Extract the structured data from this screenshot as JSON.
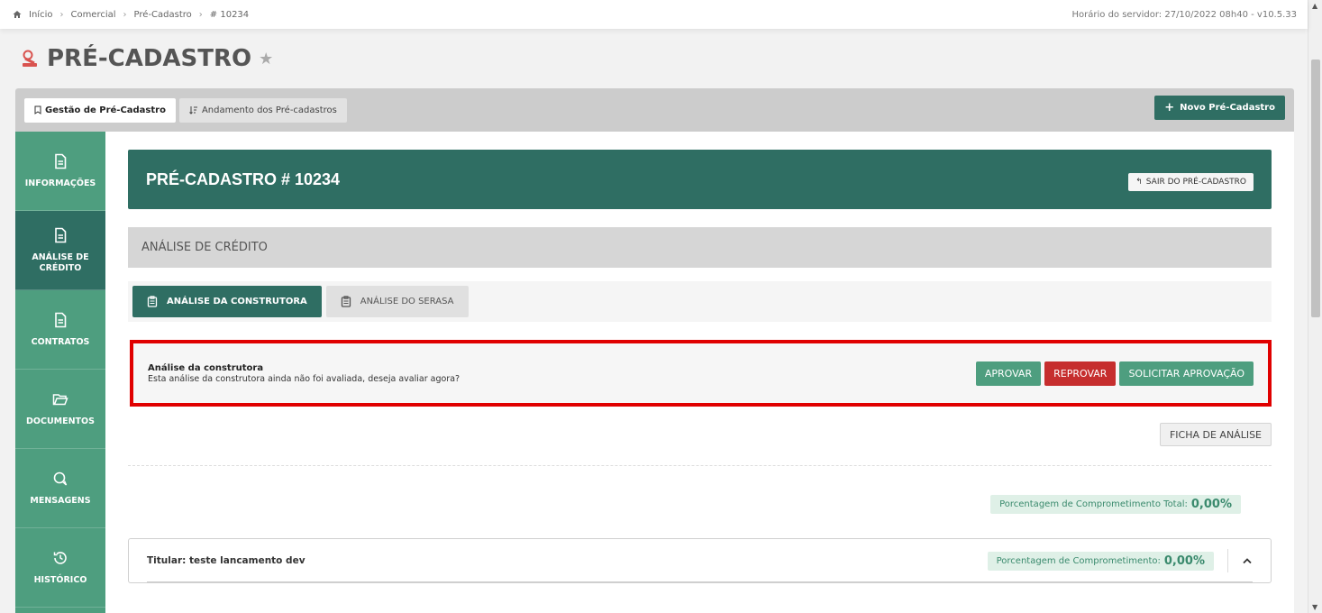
{
  "breadcrumb": [
    "Início",
    "Comercial",
    "Pré-Cadastro",
    "# 10234"
  ],
  "server_time": "Horário do servidor: 27/10/2022 08h40 - v10.5.33",
  "page_title": "PRÉ-CADASTRO",
  "tabs": {
    "gestao": "Gestão de Pré-Cadastro",
    "andamento": "Andamento dos Pré-cadastros",
    "novo": "Novo Pré-Cadastro"
  },
  "sidebar": {
    "items": [
      {
        "label": "INFORMAÇÕES",
        "icon": "document-icon"
      },
      {
        "label": "ANÁLISE DE CRÉDITO",
        "icon": "document-icon"
      },
      {
        "label": "CONTRATOS",
        "icon": "document-icon"
      },
      {
        "label": "DOCUMENTOS",
        "icon": "folder-icon"
      },
      {
        "label": "MENSAGENS",
        "icon": "chat-icon"
      },
      {
        "label": "HISTÓRICO",
        "icon": "history-icon"
      }
    ]
  },
  "header": {
    "title": "PRÉ-CADASTRO # 10234",
    "sair": "SAIR DO PRÉ-CADASTRO"
  },
  "section_title": "ANÁLISE DE CRÉDITO",
  "subtabs": {
    "construtora": "ANÁLISE DA CONSTRUTORA",
    "serasa": "ANÁLISE DO SERASA"
  },
  "alert": {
    "title": "Análise da construtora",
    "message": "Esta análise da construtora ainda não foi avaliada, deseja avaliar agora?",
    "aprovar": "APROVAR",
    "reprovar": "REPROVAR",
    "solicitar": "SOLICITAR APROVAÇÃO"
  },
  "ficha": "FICHA DE ANÁLISE",
  "percent_total": {
    "label": "Porcentagem de Comprometimento Total:",
    "value": "0,00%"
  },
  "titular": {
    "label": "Titular: teste lancamento dev",
    "pct_label": "Porcentagem de Comprometimento:",
    "pct_value": "0,00%"
  },
  "colors": {
    "primary": "#2f6e63",
    "sidebar": "#4e9e7f",
    "danger": "#c62e2e",
    "alert_border": "#e00000"
  }
}
